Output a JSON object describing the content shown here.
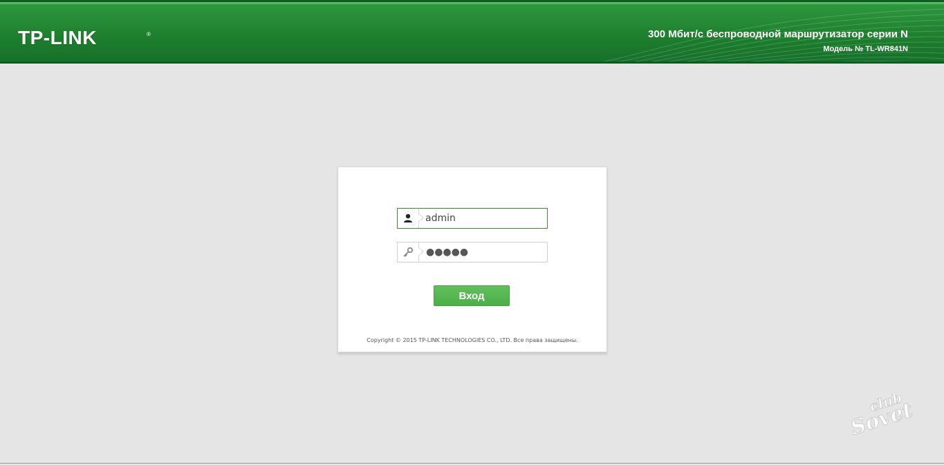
{
  "header": {
    "logo": "TP-LINK",
    "logo_reg": "®",
    "model_title": "300 Мбит/с беспроводной маршрутизатор серии N",
    "model_number": "Модель № TL-WR841N",
    "colors": {
      "header_green": "#1e7f2e",
      "accent": "#4caf46"
    }
  },
  "login": {
    "username_icon": "user-icon",
    "username_value": "admin",
    "password_icon": "key-icon",
    "password_masked": "●●●●●",
    "submit_label": "Вход",
    "copyright": "Copyright © 2015 TP-LINK TECHNOLOGIES CO., LTD. Все права защищены."
  },
  "watermark": {
    "text_top": "club",
    "text_bottom": "Sovet"
  }
}
